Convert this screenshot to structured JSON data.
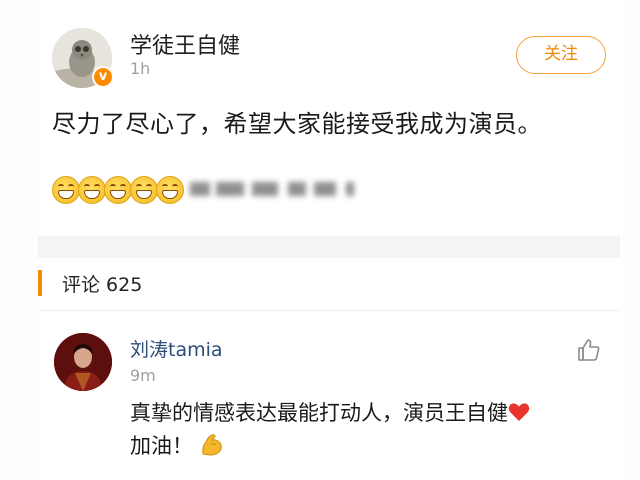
{
  "post": {
    "username": "学徒王自健",
    "time": "1h",
    "follow_label": "关注",
    "content": "尽力了尽心了，希望大家能接受我成为演员。",
    "verified_mark": "v",
    "emoji_icon": "grinning-emoji-icon",
    "emoji_count": 5
  },
  "comments_section": {
    "label": "评论 625",
    "accent_color": "#f08a00"
  },
  "comment": {
    "username": "刘涛tamia",
    "time": "9m",
    "text_line1": "真挚的情感表达最能打动人，演员王自健",
    "text_line2": "加油！",
    "icons": [
      "thumbs-up-icon",
      "heart-icon",
      "muscle-icon"
    ]
  },
  "colors": {
    "follow_border": "#f3a33a",
    "follow_text": "#f08a00",
    "comment_name": "#2b4d7a",
    "timestamp": "#a0a0a0"
  }
}
